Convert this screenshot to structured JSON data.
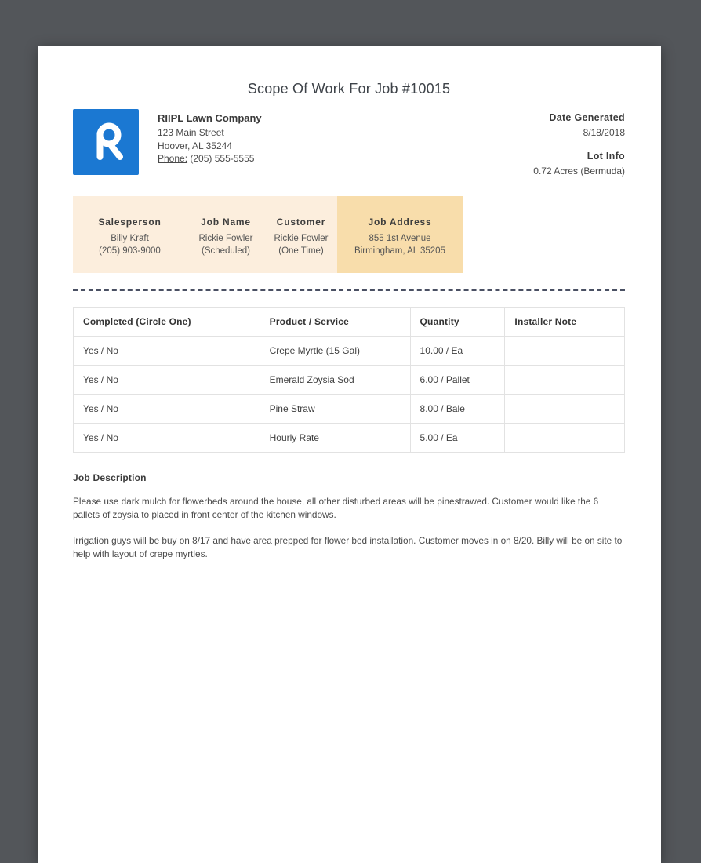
{
  "page": {
    "title": "Scope Of Work For Job #10015"
  },
  "company": {
    "logo_icon": "riipl-r-logo",
    "name": "RIIPL Lawn Company",
    "address_line1": "123 Main Street",
    "address_line2": "Hoover, AL 35244",
    "phone_label": "Phone:",
    "phone_number": "(205) 555-5555"
  },
  "meta": {
    "date_generated_label": "Date Generated",
    "date_generated": "8/18/2018",
    "lot_info_label": "Lot Info",
    "lot_info": "0.72 Acres (Bermuda)"
  },
  "job_info": [
    {
      "label": "Salesperson",
      "line1": "Billy Kraft",
      "line2": "(205) 903-9000"
    },
    {
      "label": "Job Name",
      "line1": "Rickie Fowler",
      "line2": "(Scheduled)"
    },
    {
      "label": "Customer",
      "line1": "Rickie Fowler",
      "line2": "(One Time)"
    },
    {
      "label": "Job Address",
      "line1": "855 1st Avenue",
      "line2": "Birmingham, AL 35205"
    }
  ],
  "work_table": {
    "columns": [
      "Completed (Circle One)",
      "Product / Service",
      "Quantity",
      "Installer Note"
    ],
    "rows": [
      [
        "Yes / No",
        "Crepe Myrtle (15 Gal)",
        "10.00 / Ea",
        ""
      ],
      [
        "Yes / No",
        "Emerald Zoysia Sod",
        "6.00 / Pallet",
        ""
      ],
      [
        "Yes / No",
        "Pine Straw",
        "8.00 / Bale",
        ""
      ],
      [
        "Yes / No",
        "Hourly Rate",
        "5.00 / Ea",
        ""
      ]
    ]
  },
  "job_description": {
    "heading": "Job Description",
    "paragraphs": [
      "Please use dark mulch for flowerbeds around the house, all other disturbed areas will be pinestrawed. Customer would like the 6 pallets of zoysia to placed in front center of the kitchen windows.",
      "Irrigation guys will be buy on 8/17 and have area prepped for flower bed installation. Customer moves in on 8/20. Billy will be on site to help with layout of crepe myrtles."
    ]
  },
  "colors": {
    "background": "#53565a",
    "paper": "#ffffff",
    "logo_blue": "#1b78d2",
    "info_bar_bg": "#fceedd",
    "info_bar_highlight_bg": "#f8ddab",
    "divider": "#4a5063",
    "table_border": "#e2e2e2"
  }
}
